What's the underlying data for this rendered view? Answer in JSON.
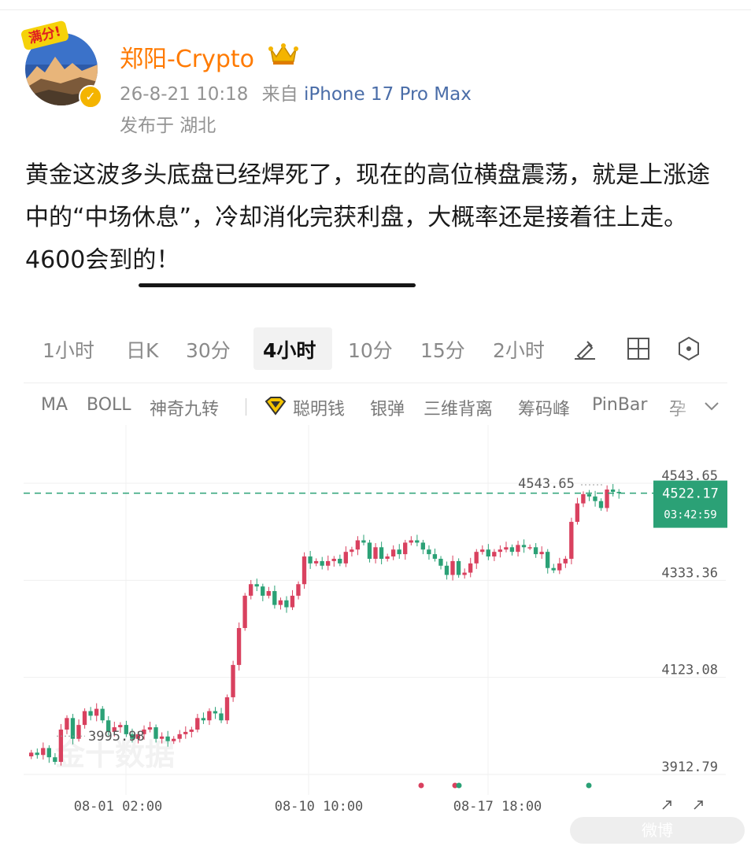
{
  "post": {
    "badge": "满分!",
    "username": "郑阳-Crypto",
    "time": "26-8-21 10:18",
    "source_prefix": "来自",
    "source_device": "iPhone 17 Pro Max",
    "location": "发布于 湖北",
    "text": "黄金这波多头底盘已经焊死了，现在的高位横盘震荡，就是上涨途中的“中场休息”，冷却消化完获利盘，大概率还是接着往上走。4600会到的！",
    "icons": [
      "crown-icon",
      "verified-icon"
    ]
  },
  "chart_ui": {
    "tabs": [
      "1小时",
      "日K",
      "30分",
      "4小时",
      "10分",
      "15分",
      "2小时"
    ],
    "active_tab": "4小时",
    "toolbar_icons": [
      "draw-tool-icon",
      "grid-layout-icon",
      "settings-hexagon-icon"
    ],
    "indicators": [
      "MA",
      "BOLL",
      "神奇九转",
      "聪明钱",
      "银弹",
      "三维背离",
      "筹码峰",
      "PinBar",
      "孕"
    ],
    "indicator_icons": [
      "diamond-icon",
      "chevron-down-icon"
    ],
    "watermark": "金十数据",
    "footer_mark": "微博"
  },
  "chart_data": {
    "type": "candlestick",
    "y_ticks": [
      "4543.65",
      "4333.36",
      "4123.08",
      "3912.79"
    ],
    "x_ticks": [
      "08-01 02:00",
      "08-10 10:00",
      "08-17 18:00"
    ],
    "ylim": [
      3912.79,
      4543.65
    ],
    "current_price": "4522.17",
    "countdown": "03:42:59",
    "high_label": "4543.65",
    "low_label": "3995.98",
    "colors": {
      "up": "#d9415f",
      "down": "#2ba176",
      "price_tag": "#2ba176"
    },
    "closes": [
      3960,
      3955,
      3970,
      3950,
      3940,
      4010,
      4035,
      3990,
      4020,
      4050,
      4040,
      4055,
      4030,
      4005,
      4015,
      4020,
      4000,
      3990,
      4000,
      4010,
      4015,
      3990,
      3995,
      3985,
      3990,
      4000,
      4005,
      4010,
      4035,
      4030,
      4050,
      4045,
      4030,
      4080,
      4150,
      4230,
      4300,
      4325,
      4320,
      4300,
      4310,
      4280,
      4290,
      4275,
      4300,
      4325,
      4385,
      4370,
      4375,
      4365,
      4375,
      4380,
      4370,
      4395,
      4400,
      4420,
      4415,
      4380,
      4405,
      4380,
      4385,
      4400,
      4390,
      4415,
      4420,
      4415,
      4400,
      4390,
      4380,
      4365,
      4345,
      4375,
      4345,
      4350,
      4370,
      4395,
      4400,
      4385,
      4395,
      4400,
      4405,
      4395,
      4410,
      4405,
      4405,
      4390,
      4395,
      4360,
      4355,
      4370,
      4380,
      4460,
      4500,
      4520,
      4515,
      4505,
      4490,
      4530,
      4525,
      4522.17
    ],
    "x_labels_positions": "08-01 02:00 / 08-10 10:00 / 08-17 18:00"
  }
}
